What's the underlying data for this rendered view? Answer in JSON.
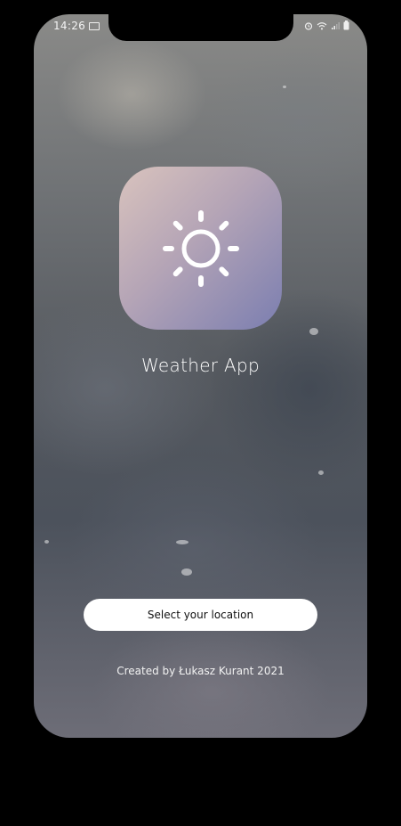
{
  "status_bar": {
    "time": "14:26",
    "icons": [
      "notification-icon",
      "alarm-icon",
      "wifi-icon",
      "signal-icon",
      "battery-icon"
    ]
  },
  "app": {
    "icon": "sun-icon",
    "title": "Weather App",
    "gradient_colors": [
      "#d9c3bd",
      "#b4a4b6",
      "#7b7eb0"
    ]
  },
  "actions": {
    "select_location_label": "Select your location"
  },
  "footer": {
    "credit": "Created by Łukasz Kurant 2021"
  }
}
